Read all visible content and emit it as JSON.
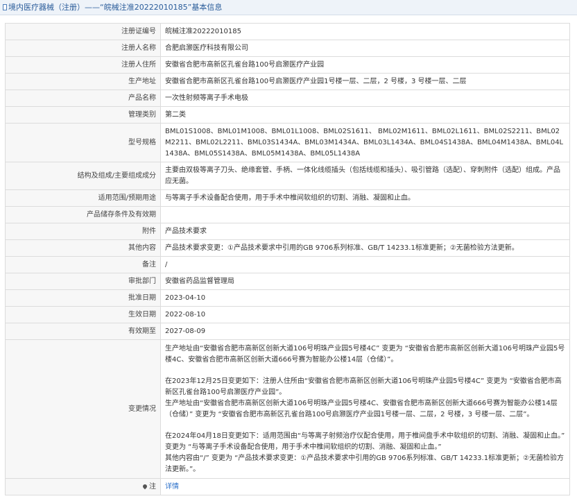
{
  "header": {
    "title": "境内医疗器械（注册）——“皖械注准20222010185”基本信息"
  },
  "rows": [
    {
      "label": "注册证编号",
      "value": "皖械注准20222010185"
    },
    {
      "label": "注册人名称",
      "value": "合肥启灏医疗科技有限公司"
    },
    {
      "label": "注册人住所",
      "value": "安徽省合肥市高新区孔雀台路100号启灏医疗产业园"
    },
    {
      "label": "生产地址",
      "value": "安徽省合肥市高新区孔雀台路100号启灏医疗产业园1号楼一层、二层，2 号楼，3 号楼一层、二层"
    },
    {
      "label": "产品名称",
      "value": "一次性射频等离子手术电极"
    },
    {
      "label": "管理类别",
      "value": "第二类"
    },
    {
      "label": "型号规格",
      "value": "BML01S1008、BML01M1008、BML01L1008、BML02S1611、 BML02M1611、BML02L1611、BML02S2211、BML02M2211、BML02L2211、BML03S1434A、BML03M1434A、BML03L1434A、BML04S1438A、BML04M1438A、BML04L1438A、BML05S1438A、BML05M1438A、BML05L1438A"
    },
    {
      "label": "结构及组成/主要组成成分",
      "value": "主要由双极等离子刀头、绝缘套管、手柄、一体化线缆插头（包括线缆和插头）、吸引管路（选配）、穿刺附件（选配）组成。产品应无菌。"
    },
    {
      "label": "适用范围/预期用途",
      "value": "与等离子手术设备配合使用，用于手术中椎间软组织的切割、消融、凝固和止血。"
    },
    {
      "label": "产品储存条件及有效期",
      "value": ""
    },
    {
      "label": "附件",
      "value": "产品技术要求"
    },
    {
      "label": "其他内容",
      "value": "产品技术要求变更：①产品技术要求中引用的GB 9706系列标准、GB/T 14233.1标准更新；②无菌检验方法更新。"
    },
    {
      "label": "备注",
      "value": "/"
    },
    {
      "label": "审批部门",
      "value": "安徽省药品监督管理局"
    },
    {
      "label": "批准日期",
      "value": "2023-04-10"
    },
    {
      "label": "生效日期",
      "value": "2022-08-10"
    },
    {
      "label": "有效期至",
      "value": "2027-08-09"
    }
  ],
  "change": {
    "label": "变更情况",
    "p1": "生产地址由“安徽省合肥市高新区创新大道106号明珠产业园5号楼4C” 变更为 “安徽省合肥市高新区创新大道106号明珠产业园5号楼4C、安徽省合肥市高新区创新大道666号赛为智能办公楼14层（仓储）”。",
    "p2": "在2023年12月25日变更如下：注册人住所由“安徽省合肥市高新区创新大道106号明珠产业园5号楼4C” 变更为 “安徽省合肥市高新区孔雀台路100号启灏医疗产业园”。",
    "p3": "生产地址由“安徽省合肥市高新区创新大道106号明珠产业园5号楼4C、安徽省合肥市高新区创新大道666号赛为智能办公楼14层（仓储）” 变更为 “安徽省合肥市高新区孔雀台路100号启灏医疗产业园1号楼一层、二层，2 号楼，3 号楼一层、二层”。",
    "p4": "在2024年04月18日变更如下：适用范围由“与等离子射频治疗仪配合使用，用于椎间盘手术中软组织的切割、消融、凝固和止血。” 变更为 “与等离子手术设备配合使用，用于手术中椎间软组织的切割、消融、凝固和止血。”",
    "p5": "其他内容由“/” 变更为 “产品技术要求变更：①产品技术要求中引用的GB 9706系列标准、GB/T 14233.1标准更新；②无菌检验方法更新。”。"
  },
  "note": {
    "label": "注",
    "icon": "pin-icon",
    "link": "详情"
  }
}
